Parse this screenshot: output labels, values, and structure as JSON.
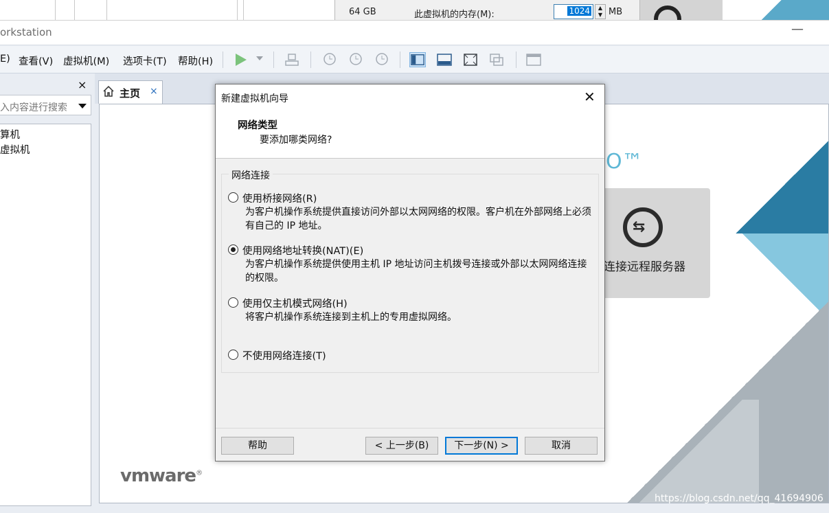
{
  "background_window": {
    "mem_size": "64 GB",
    "mem_label": "此虚拟机的内存(M):",
    "mem_value": "1024",
    "mem_unit": "MB"
  },
  "app": {
    "title": "orkstation",
    "minimize": "—"
  },
  "menu": {
    "items": [
      "E)",
      "查看(V)",
      "虚拟机(M)",
      "选项卡(T)",
      "帮助(H)"
    ]
  },
  "library": {
    "close": "×",
    "search_placeholder": "入内容进行搜索",
    "tree": [
      "算机",
      "虚拟机"
    ]
  },
  "tabs": {
    "home_label": "主页",
    "home_close": "×"
  },
  "home": {
    "trademark": "O™",
    "remote_server_label": "连接远程服务器",
    "remote_icon": "remote-connect-icon",
    "logo": "vmware",
    "logo_mark": "®"
  },
  "watermark": "https://blog.csdn.net/qq_41694906",
  "dialog": {
    "title": "新建虚拟机向导",
    "close": "✕",
    "heading": "网络类型",
    "subheading": "要添加哪类网络?",
    "group_label": "网络连接",
    "options": [
      {
        "label": "使用桥接网络(R)",
        "desc": "为客户机操作系统提供直接访问外部以太网网络的权限。客户机在外部网络上必须有自己的 IP 地址。",
        "selected": false
      },
      {
        "label": "使用网络地址转换(NAT)(E)",
        "desc": "为客户机操作系统提供使用主机 IP 地址访问主机拨号连接或外部以太网网络连接的权限。",
        "selected": true
      },
      {
        "label": "使用仅主机模式网络(H)",
        "desc": "将客户机操作系统连接到主机上的专用虚拟网络。",
        "selected": false
      },
      {
        "label": "不使用网络连接(T)",
        "desc": "",
        "selected": false
      }
    ],
    "buttons": {
      "help": "帮助",
      "back": "< 上一步(B)",
      "next": "下一步(N) >",
      "cancel": "取消"
    }
  },
  "colors": {
    "accent": "#0078d7",
    "play": "#7cc37c",
    "vmware_blue_dark": "#2a7ca3",
    "vmware_blue_light": "#86c7df"
  }
}
